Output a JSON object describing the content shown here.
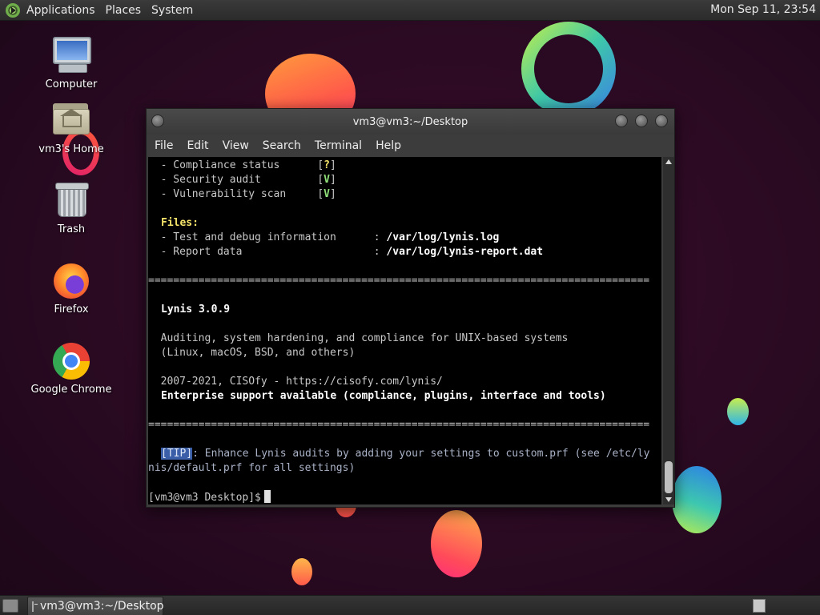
{
  "top_panel": {
    "menus": [
      "Applications",
      "Places",
      "System"
    ],
    "clock": "Mon Sep 11, 23:54"
  },
  "desktop_icons": [
    {
      "label": "Computer",
      "icon": "computer-icon"
    },
    {
      "label": "vm3's Home",
      "icon": "home-folder-icon"
    },
    {
      "label": "Trash",
      "icon": "trash-icon"
    },
    {
      "label": "Firefox",
      "icon": "firefox-icon"
    },
    {
      "label": "Google Chrome",
      "icon": "chrome-icon"
    }
  ],
  "window": {
    "title": "vm3@vm3:~/Desktop",
    "menu": [
      "File",
      "Edit",
      "View",
      "Search",
      "Terminal",
      "Help"
    ]
  },
  "terminal": {
    "status_lines": [
      {
        "label": "  - Compliance status      ",
        "mark": "?"
      },
      {
        "label": "  - Security audit         ",
        "mark": "V"
      },
      {
        "label": "  - Vulnerability scan     ",
        "mark": "V"
      }
    ],
    "files_heading": "Files:",
    "file_lines": [
      {
        "label": "  - Test and debug information      : ",
        "path": "/var/log/lynis.log"
      },
      {
        "label": "  - Report data                     : ",
        "path": "/var/log/lynis-report.dat"
      }
    ],
    "separator": "================================================================================",
    "product": "Lynis 3.0.9",
    "desc1": "  Auditing, system hardening, and compliance for UNIX-based systems",
    "desc2": "  (Linux, macOS, BSD, and others)",
    "copyright": "  2007-2021, CISOfy - https://cisofy.com/lynis/",
    "support": "Enterprise support available (compliance, plugins, interface and tools)",
    "tip_tag": "[TIP]",
    "tip_text1": ": Enhance Lynis audits by adding your settings to custom.prf (see /etc/ly",
    "tip_text2": "nis/default.prf for all settings)",
    "prompt": "[vm3@vm3 Desktop]$"
  },
  "taskbar": {
    "task_label": "vm3@vm3:~/Desktop"
  }
}
